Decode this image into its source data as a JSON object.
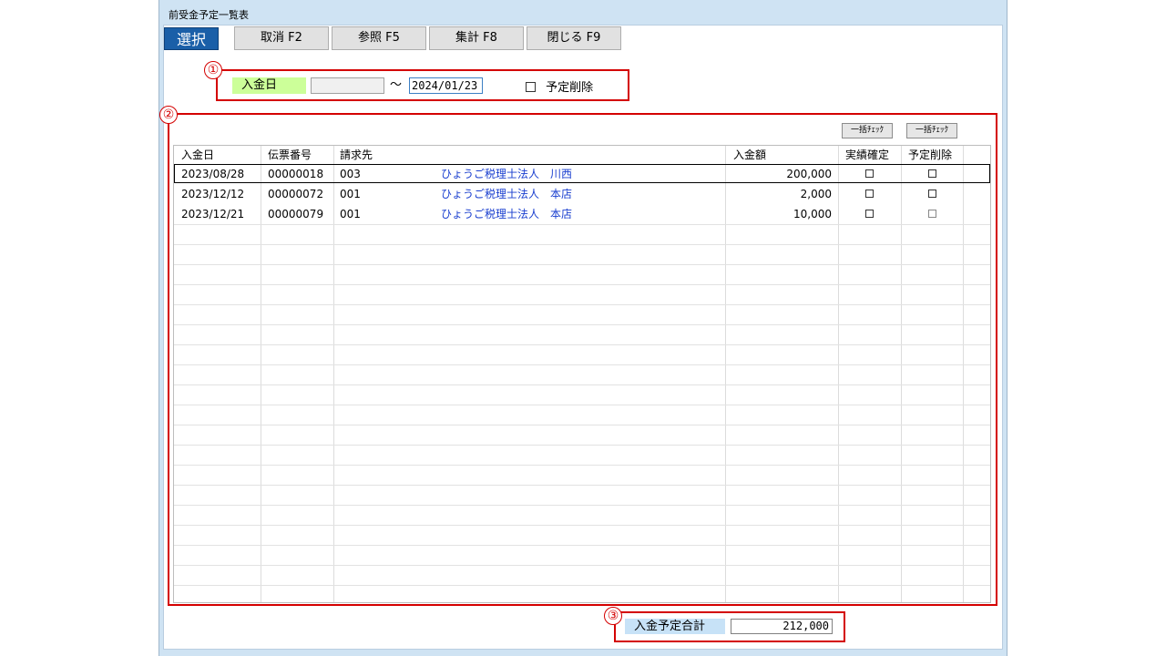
{
  "window": {
    "title": "前受金予定一覧表"
  },
  "toolbar": {
    "select_label": "選択",
    "cancel_label": "取消 F2",
    "browse_label": "参照 F5",
    "total_label": "集計 F8",
    "close_label": "閉じる F9"
  },
  "annotations": {
    "one": "①",
    "two": "②",
    "three": "③"
  },
  "filter": {
    "date_label": "入金日",
    "date_from": "",
    "tilde": "～",
    "date_to": "2024/01/23",
    "planned_delete_label": "予定削除"
  },
  "bulk": {
    "check1": "一括ﾁｪｯｸ",
    "check2": "一括ﾁｪｯｸ"
  },
  "table": {
    "headers": [
      "入金日",
      "伝票番号",
      "請求先",
      "入金額",
      "実績確定",
      "予定削除"
    ],
    "rows": [
      {
        "date": "2023/08/28",
        "slip": "00000018",
        "code": "003",
        "name": "ひょうご税理士法人　川西",
        "amount": "200,000"
      },
      {
        "date": "2023/12/12",
        "slip": "00000072",
        "code": "001",
        "name": "ひょうご税理士法人　本店",
        "amount": "2,000"
      },
      {
        "date": "2023/12/21",
        "slip": "00000079",
        "code": "001",
        "name": "ひょうご税理士法人　本店",
        "amount": "10,000"
      }
    ]
  },
  "summary": {
    "label": "入金予定合計",
    "value": "212,000"
  },
  "colors": {
    "accent": "#1a5fa8",
    "annotation": "#d40000",
    "label_green": "#ccff99",
    "label_blue": "#c7e2f7"
  }
}
